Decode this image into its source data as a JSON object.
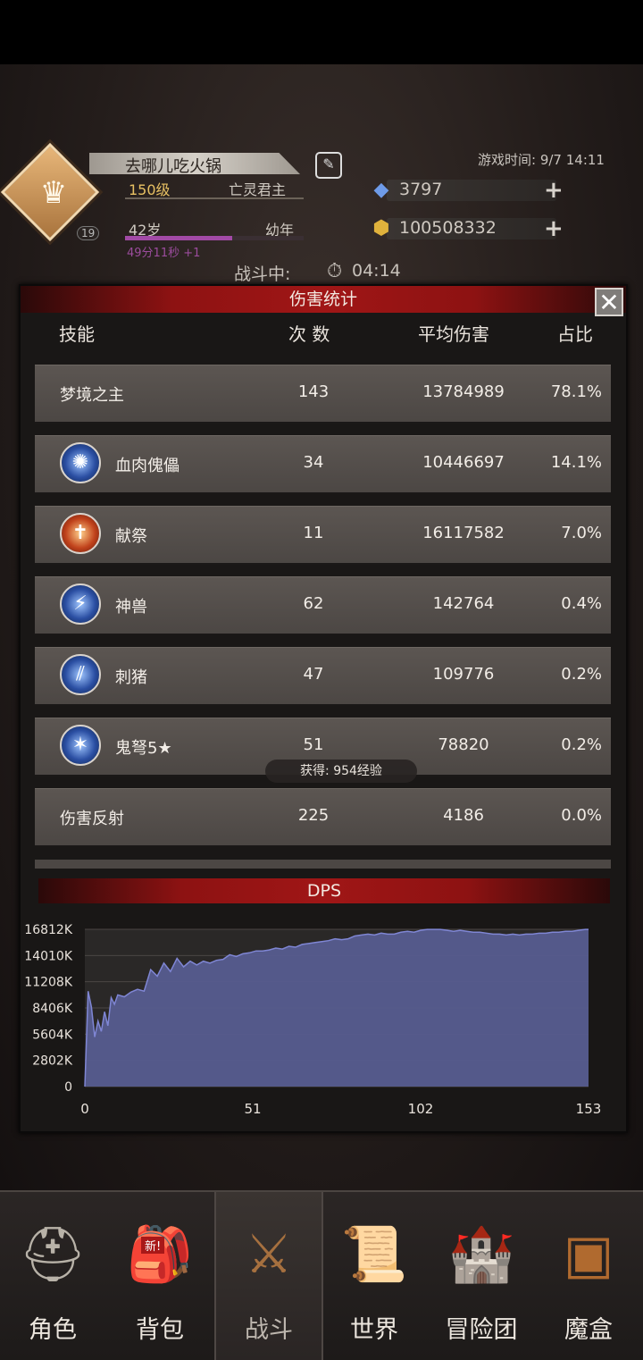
{
  "player": {
    "crest_level": "19",
    "name": "去哪儿吃火锅",
    "level": "150级",
    "title": "亡灵君主",
    "age": "42岁",
    "life_stage": "幼年",
    "age_timer": "49分11秒 +1",
    "age_progress": 0.6
  },
  "game_time": "游戏时间: 9/7 14:11",
  "resources": {
    "gems": "3797",
    "gold": "100508332"
  },
  "battle": {
    "status": "战斗中:",
    "timer": "04:14"
  },
  "damage_stats": {
    "title": "伤害统计",
    "headers": {
      "skill": "技能",
      "count": "次 数",
      "avg": "平均伤害",
      "pct": "占比"
    },
    "rows": [
      {
        "name": "梦境之主",
        "count": "143",
        "avg": "13784989",
        "pct": "78.1%",
        "icon": ""
      },
      {
        "name": "血肉傀儡",
        "count": "34",
        "avg": "10446697",
        "pct": "14.1%",
        "icon": "lightning-orb-icon"
      },
      {
        "name": "献祭",
        "count": "11",
        "avg": "16117582",
        "pct": "7.0%",
        "icon": "sacrifice-cross-icon"
      },
      {
        "name": "神兽",
        "count": "62",
        "avg": "142764",
        "pct": "0.4%",
        "icon": "beast-claw-icon"
      },
      {
        "name": "刺猪",
        "count": "47",
        "avg": "109776",
        "pct": "0.2%",
        "icon": "slash-icon"
      },
      {
        "name": "鬼弩5★",
        "count": "51",
        "avg": "78820",
        "pct": "0.2%",
        "icon": "crossbow-icon"
      },
      {
        "name": "伤害反射",
        "count": "225",
        "avg": "4186",
        "pct": "0.0%",
        "icon": ""
      }
    ],
    "exp_toast": "获得: 954经验"
  },
  "chart_data": {
    "type": "area",
    "title": "DPS",
    "x_ticks": [
      0,
      51,
      102,
      153
    ],
    "y_ticks": [
      "0",
      "2802K",
      "5604K",
      "8406K",
      "11208K",
      "14010K",
      "16812K"
    ],
    "xlim": [
      0,
      153
    ],
    "ylim": [
      0,
      16812
    ],
    "grid": true,
    "fill_color": "#565c8f",
    "line_color": "#7f86d4",
    "x": [
      0,
      1,
      2,
      3,
      4,
      5,
      6,
      7,
      8,
      9,
      10,
      12,
      14,
      16,
      18,
      20,
      22,
      24,
      26,
      28,
      30,
      32,
      34,
      36,
      38,
      40,
      42,
      44,
      46,
      48,
      50,
      52,
      54,
      56,
      58,
      60,
      62,
      64,
      66,
      68,
      70,
      72,
      74,
      76,
      78,
      80,
      82,
      84,
      86,
      88,
      90,
      92,
      94,
      96,
      98,
      100,
      102,
      104,
      106,
      108,
      110,
      112,
      114,
      116,
      118,
      120,
      122,
      124,
      126,
      128,
      130,
      132,
      134,
      136,
      138,
      140,
      142,
      144,
      146,
      148,
      150,
      152,
      153
    ],
    "values": [
      0,
      10200,
      8500,
      5300,
      7000,
      5900,
      8000,
      6500,
      9500,
      8800,
      9800,
      9600,
      10100,
      10400,
      10200,
      12500,
      11800,
      13200,
      12300,
      13700,
      12800,
      13400,
      13000,
      13400,
      13200,
      13500,
      13600,
      14100,
      13900,
      14200,
      14300,
      14500,
      14500,
      14600,
      14800,
      14700,
      15000,
      14900,
      15200,
      15300,
      15400,
      15500,
      15600,
      15800,
      15700,
      15800,
      16100,
      16200,
      16300,
      16200,
      16400,
      16300,
      16300,
      16500,
      16600,
      16500,
      16700,
      16800,
      16800,
      16800,
      16700,
      16600,
      16700,
      16600,
      16500,
      16500,
      16400,
      16300,
      16300,
      16200,
      16300,
      16200,
      16300,
      16300,
      16400,
      16400,
      16500,
      16500,
      16600,
      16600,
      16700,
      16800,
      16800
    ]
  },
  "nav": [
    {
      "label": "角色",
      "icon": "helmet-icon"
    },
    {
      "label": "背包",
      "icon": "backpack-icon",
      "badge": "新!"
    },
    {
      "label": "战斗",
      "icon": "shield-sword-icon",
      "active": true
    },
    {
      "label": "世界",
      "icon": "scroll-map-icon"
    },
    {
      "label": "冒险团",
      "icon": "castle-icon"
    },
    {
      "label": "魔盒",
      "icon": "magic-box-icon"
    }
  ]
}
